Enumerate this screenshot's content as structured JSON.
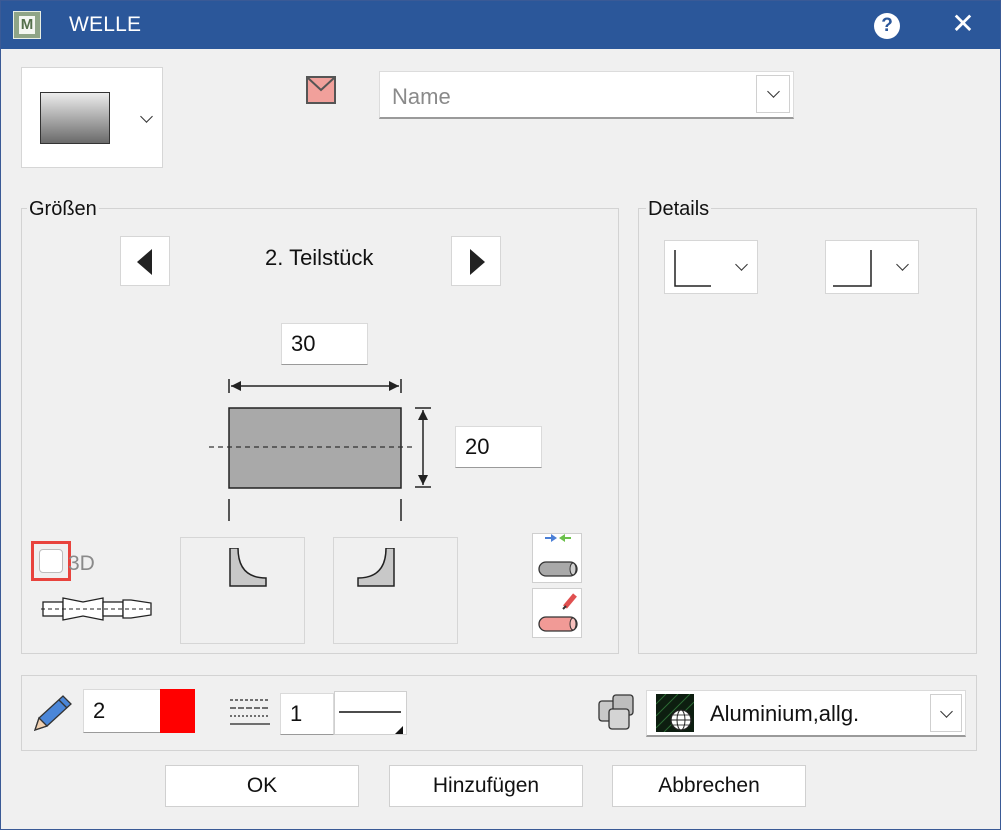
{
  "window": {
    "title": "WELLE",
    "app_icon_letter": "M",
    "help_glyph": "?",
    "close_glyph": "✕"
  },
  "header": {
    "fill_icon": "fill-gradient-swatch",
    "name_placeholder": "Name",
    "name_value": ""
  },
  "sizes": {
    "group_label": "Größen",
    "segment_label": "2. Teilstück",
    "width_value": "30",
    "height_value": "20",
    "checkbox_3d_label": "3D",
    "checkbox_3d_checked": false
  },
  "details": {
    "group_label": "Details"
  },
  "bottom": {
    "pen_value": "2",
    "pen_color": "#ff0000",
    "line_value": "1",
    "material_label": "Aluminium,allg."
  },
  "buttons": {
    "ok": "OK",
    "add": "Hinzufügen",
    "cancel": "Abbrechen"
  },
  "colors": {
    "titlebar": "#2b579a",
    "checkbox_highlight": "#e8433d",
    "shape_fill": "#a9a9a9"
  }
}
